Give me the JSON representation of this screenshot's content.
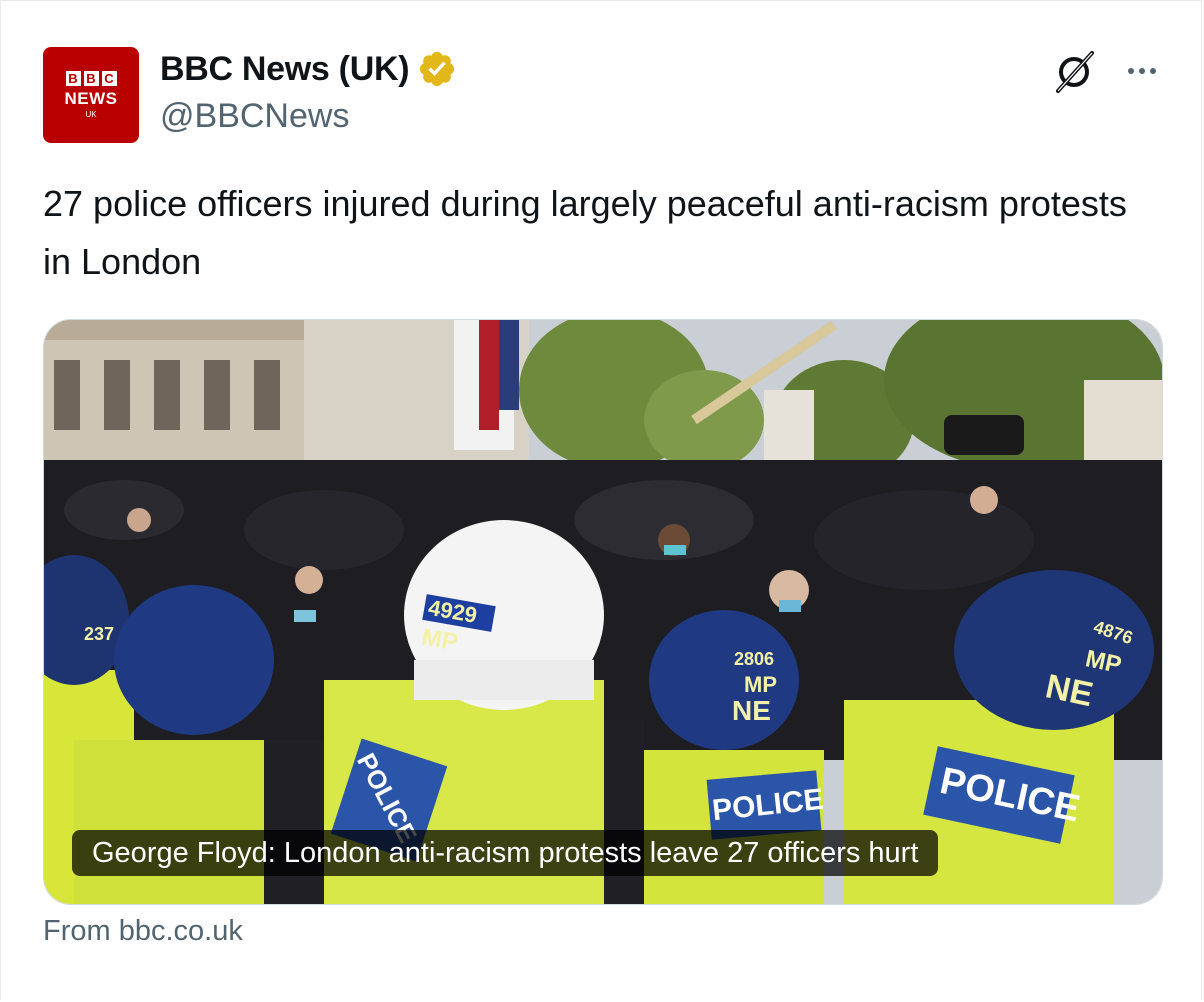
{
  "account": {
    "display_name": "BBC News (UK)",
    "handle": "@BBCNews",
    "avatar": {
      "blocks": [
        "B",
        "B",
        "C"
      ],
      "line1": "NEWS",
      "line2": "UK"
    },
    "verified_icon": "verified-badge-icon",
    "verified_color": "#e2b719"
  },
  "header_actions": {
    "grok_icon": "grok-icon",
    "more_icon": "more-options-icon"
  },
  "tweet": {
    "text": "27 police officers injured during largely peaceful anti-racism protests in London"
  },
  "link_card": {
    "image_subject": "photo",
    "helmet_numbers": [
      "4929",
      "2806",
      "4876",
      "237"
    ],
    "helmet_letters": [
      "MP",
      "NE"
    ],
    "vest_text": "POLICE",
    "title": "George Floyd: London anti-racism protests leave 27 officers hurt",
    "source": "From bbc.co.uk"
  },
  "colors": {
    "brand_red": "#b80000",
    "secondary_text": "#536471",
    "primary_text": "#0f1419",
    "border": "#cfd9de"
  }
}
